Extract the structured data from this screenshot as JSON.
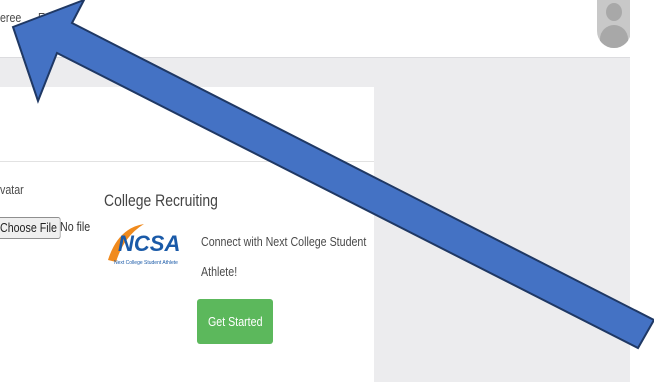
{
  "nav": {
    "referee_label": "eree",
    "entry_label": "Entry"
  },
  "avatar_section": {
    "label": "vatar",
    "choose_file_label": "Choose File",
    "no_file_text": "No file"
  },
  "recruiting": {
    "title": "College Recruiting",
    "logo_text": "NCSA",
    "logo_tagline": "Next College Student Athlete",
    "promo_line1": "Connect with Next College Student",
    "promo_line2": "Athlete!",
    "cta_label": "Get Started"
  },
  "colors": {
    "cta_green": "#5cb85c",
    "ncsa_blue": "#1a5aa8",
    "ncsa_orange": "#f08a1d",
    "annotation_arrow_fill": "#4472c4",
    "annotation_arrow_stroke": "#1f3864"
  }
}
